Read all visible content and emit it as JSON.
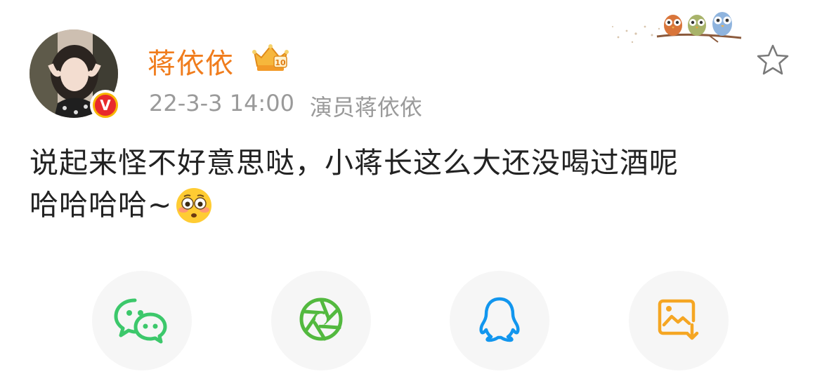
{
  "post": {
    "author": "蒋依依",
    "timestamp": "22-3-3 14:00",
    "source": "演员蒋依依",
    "text_line1": "说起来怪不好意思哒，小蒋长这么大还没喝过酒呢",
    "text_line2": "哈哈哈哈~",
    "verified_mark": "V"
  },
  "icons": {
    "author_badge": "crown-badge-icon",
    "favorite": "star-icon",
    "decoration": "owls-on-branch",
    "emoji": "flushed-face-emoji"
  },
  "share": {
    "buttons": [
      {
        "name": "wechat-share-icon",
        "color": "#3cc86b"
      },
      {
        "name": "moments-share-icon",
        "color": "#53b93f"
      },
      {
        "name": "qq-share-icon",
        "color": "#1296ee"
      },
      {
        "name": "save-image-icon",
        "color": "#f5a623"
      }
    ]
  },
  "colors": {
    "username": "#f07c1c",
    "meta": "#9a9a9a",
    "text": "#222222",
    "share_bg": "#f6f6f6"
  }
}
